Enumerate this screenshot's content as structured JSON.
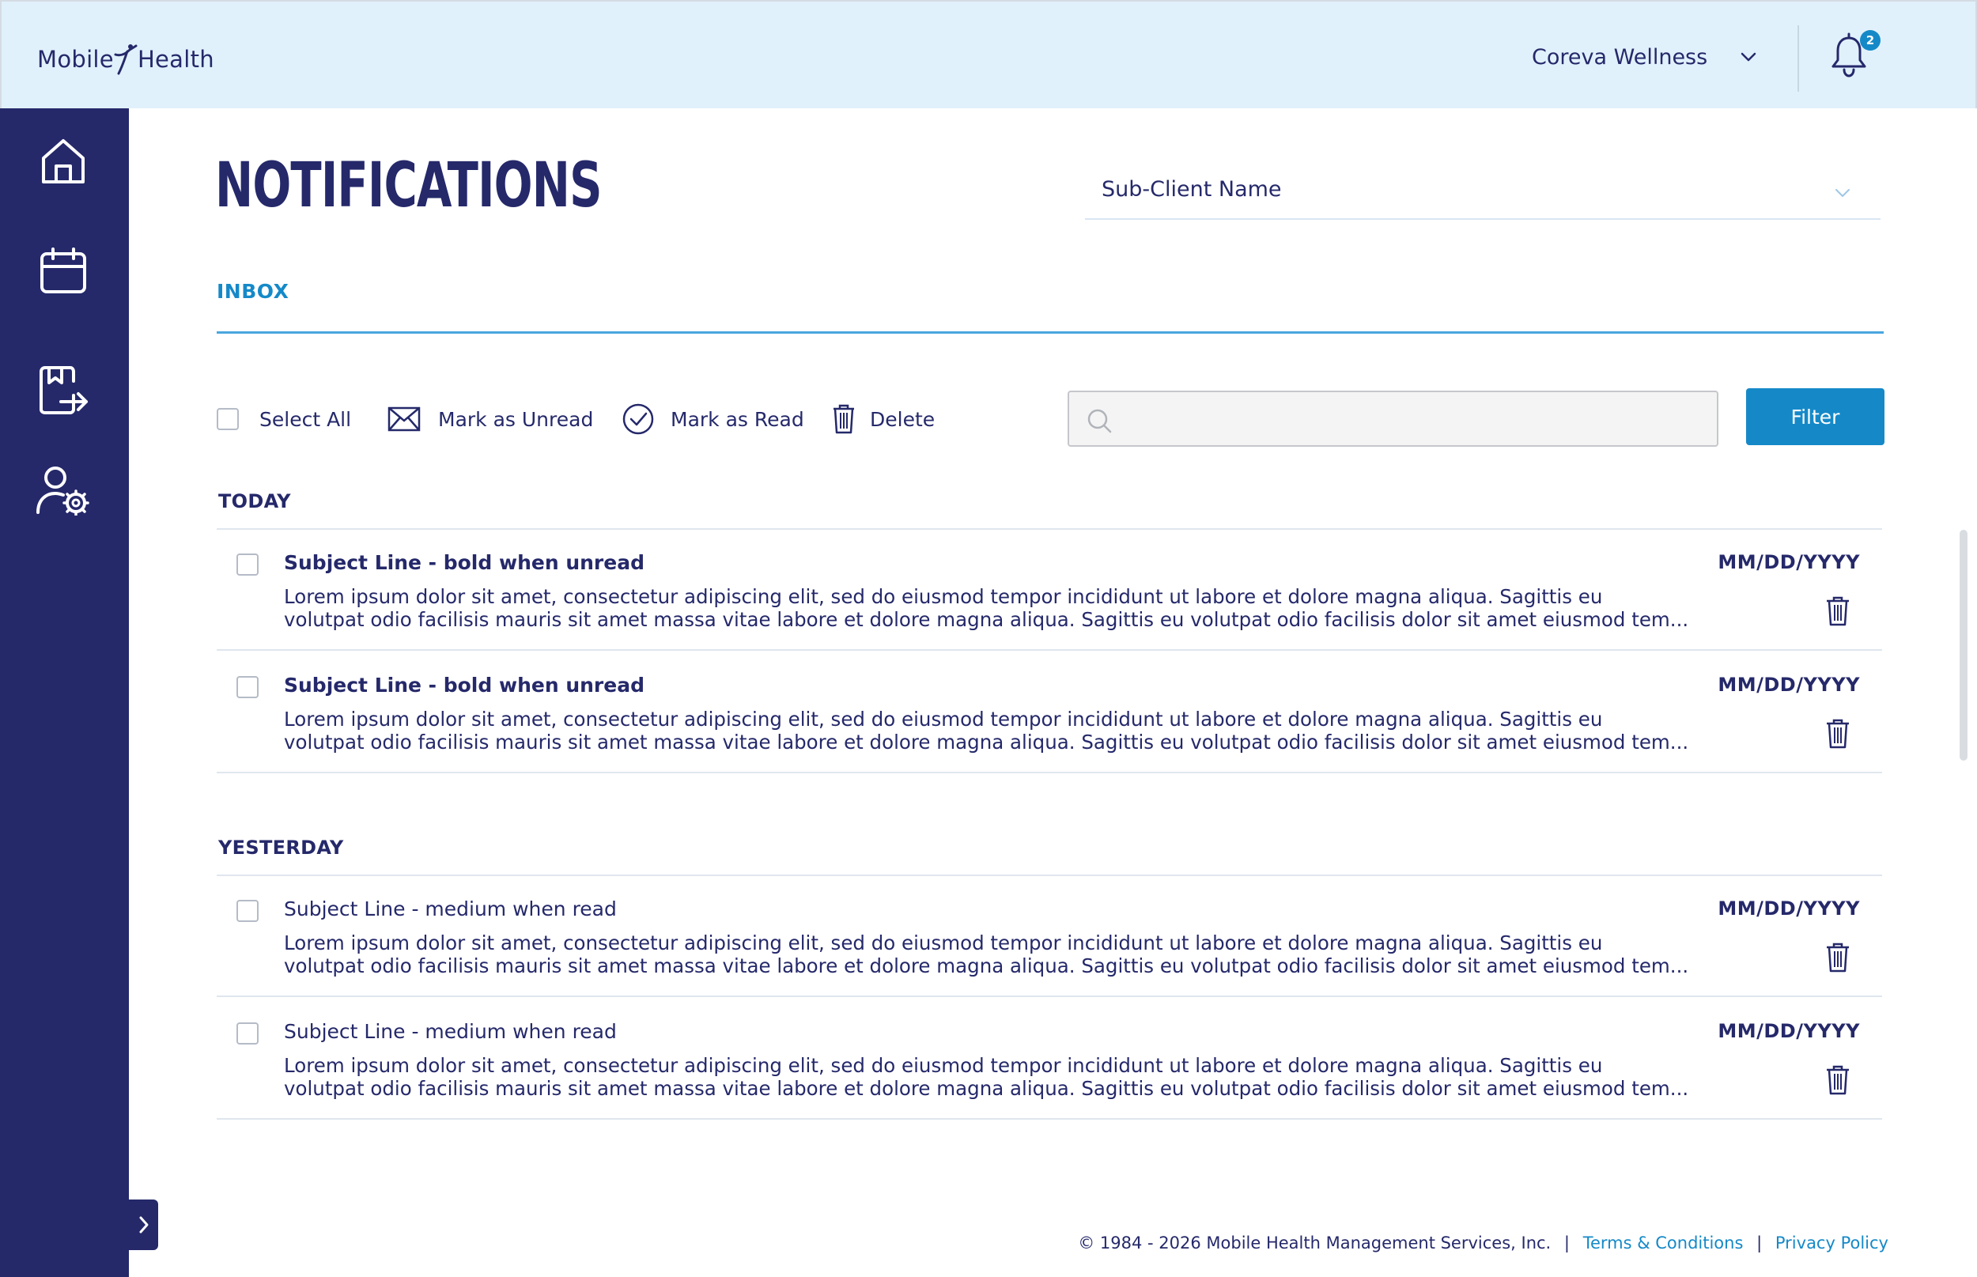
{
  "header": {
    "logo_text_left": "Mobile",
    "logo_text_right": "Health",
    "client_name": "Coreva Wellness",
    "notification_count": "2"
  },
  "sidebar": {
    "items": [
      {
        "icon": "home-icon"
      },
      {
        "icon": "calendar-icon"
      },
      {
        "icon": "records-export-icon"
      },
      {
        "icon": "user-settings-icon"
      }
    ],
    "toggle_icon": "chevron-right-icon"
  },
  "page": {
    "title": "NOTIFICATIONS",
    "subclient_label": "Sub-Client Name",
    "tab_inbox": "INBOX"
  },
  "toolbar": {
    "select_all": "Select All",
    "mark_unread": "Mark as Unread",
    "mark_read": "Mark as Read",
    "delete": "Delete",
    "search_placeholder": "",
    "filter": "Filter"
  },
  "sections": [
    {
      "heading": "TODAY",
      "messages": [
        {
          "subject": "Subject Line - bold when unread",
          "date": "MM/DD/YYYY",
          "line1": "Lorem ipsum dolor sit amet, consectetur adipiscing elit, sed do eiusmod tempor incididunt ut labore et dolore magna aliqua. Sagittis eu",
          "line2": "volutpat odio facilisis mauris sit amet massa vitae labore et dolore magna aliqua. Sagittis eu volutpat odio facilisis dolor sit amet eiusmod tem...",
          "read": false
        },
        {
          "subject": "Subject Line - bold when unread",
          "date": "MM/DD/YYYY",
          "line1": "Lorem ipsum dolor sit amet, consectetur adipiscing elit, sed do eiusmod tempor incididunt ut labore et dolore magna aliqua. Sagittis eu",
          "line2": "volutpat odio facilisis mauris sit amet massa vitae labore et dolore magna aliqua. Sagittis eu volutpat odio facilisis dolor sit amet eiusmod tem...",
          "read": false
        }
      ]
    },
    {
      "heading": "YESTERDAY",
      "messages": [
        {
          "subject": "Subject Line - medium when read",
          "date": "MM/DD/YYYY",
          "line1": "Lorem ipsum dolor sit amet, consectetur adipiscing elit, sed do eiusmod tempor incididunt ut labore et dolore magna aliqua. Sagittis eu",
          "line2": "volutpat odio facilisis mauris sit amet massa vitae labore et dolore magna aliqua. Sagittis eu volutpat odio facilisis dolor sit amet eiusmod tem...",
          "read": true
        },
        {
          "subject": "Subject Line - medium when read",
          "date": "MM/DD/YYYY",
          "line1": "Lorem ipsum dolor sit amet, consectetur adipiscing elit, sed do eiusmod tempor incididunt ut labore et dolore magna aliqua. Sagittis eu",
          "line2": "volutpat odio facilisis mauris sit amet massa vitae labore et dolore magna aliqua. Sagittis eu volutpat odio facilisis dolor sit amet eiusmod tem...",
          "read": true
        }
      ]
    }
  ],
  "footer": {
    "copyright": "© 1984 - 2026 Mobile Health Management Services, Inc.",
    "separator": "|",
    "terms": "Terms & Conditions",
    "privacy": "Privacy Policy"
  },
  "colors": {
    "navy": "#25296a",
    "accent_blue": "#1589c8",
    "header_bg": "#e1f1fc"
  }
}
